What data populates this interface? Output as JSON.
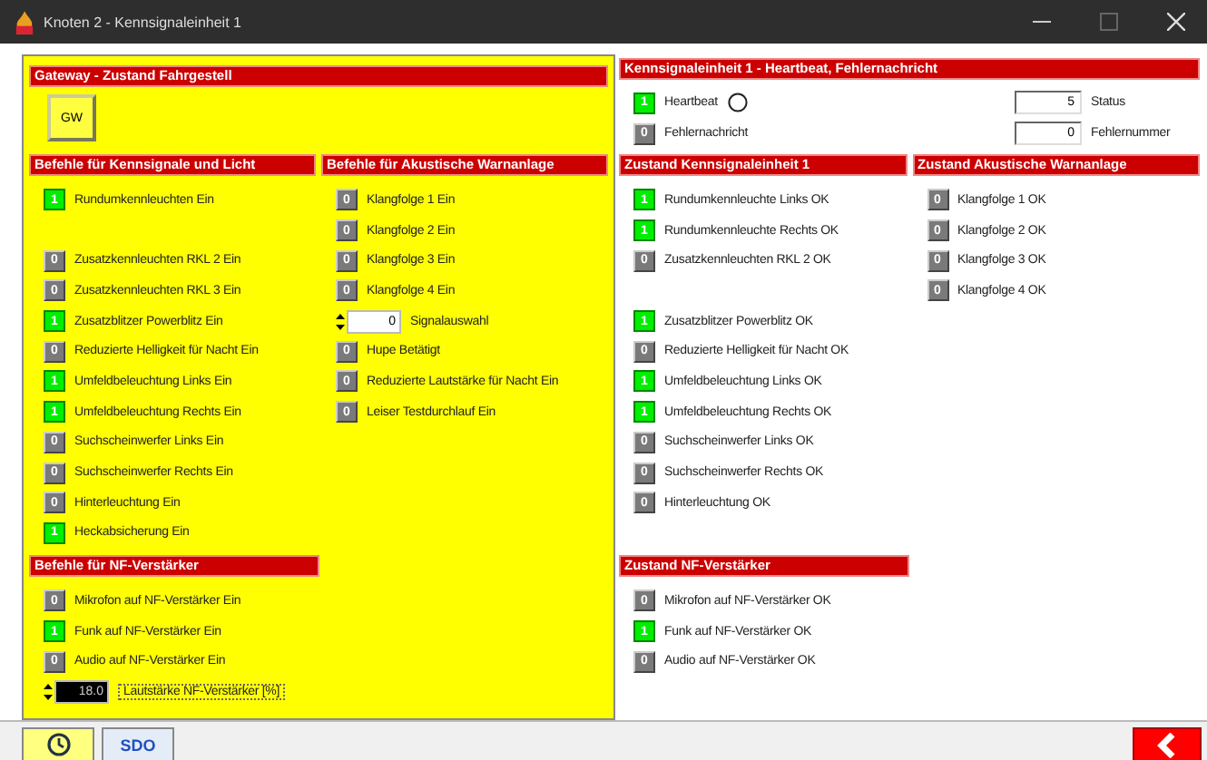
{
  "window": {
    "title": "Knoten 2 - Kennsignaleinheit 1"
  },
  "gateway": {
    "header": "Gateway - Zustand Fahrgestell",
    "button": "GW"
  },
  "light_commands": {
    "header": "Befehle für Kennsignale und Licht",
    "items": [
      {
        "kind": "indicator",
        "value": "1",
        "on": true,
        "label": "Rundumkennleuchten Ein"
      },
      {
        "kind": "spacer"
      },
      {
        "kind": "indicator",
        "value": "0",
        "on": false,
        "label": "Zusatzkennleuchten RKL 2 Ein"
      },
      {
        "kind": "indicator",
        "value": "0",
        "on": false,
        "label": "Zusatzkennleuchten RKL 3 Ein"
      },
      {
        "kind": "indicator",
        "value": "1",
        "on": true,
        "label": "Zusatzblitzer Powerblitz Ein"
      },
      {
        "kind": "indicator",
        "value": "0",
        "on": false,
        "label": "Reduzierte Helligkeit für Nacht Ein"
      },
      {
        "kind": "indicator",
        "value": "1",
        "on": true,
        "label": "Umfeldbeleuchtung Links Ein"
      },
      {
        "kind": "indicator",
        "value": "1",
        "on": true,
        "label": "Umfeldbeleuchtung Rechts Ein"
      },
      {
        "kind": "indicator",
        "value": "0",
        "on": false,
        "label": "Suchscheinwerfer Links Ein"
      },
      {
        "kind": "indicator",
        "value": "0",
        "on": false,
        "label": "Suchscheinwerfer Rechts Ein"
      },
      {
        "kind": "indicator",
        "value": "0",
        "on": false,
        "label": "Hinterleuchtung Ein"
      },
      {
        "kind": "indicator",
        "value": "1",
        "on": true,
        "label": "Heckabsicherung Ein"
      }
    ]
  },
  "acoustic_commands": {
    "header": "Befehle für Akustische Warnanlage",
    "items": [
      {
        "kind": "indicator",
        "value": "0",
        "on": false,
        "label": "Klangfolge 1 Ein"
      },
      {
        "kind": "indicator",
        "value": "0",
        "on": false,
        "label": "Klangfolge 2 Ein"
      },
      {
        "kind": "indicator",
        "value": "0",
        "on": false,
        "label": "Klangfolge 3 Ein"
      },
      {
        "kind": "indicator",
        "value": "0",
        "on": false,
        "label": "Klangfolge 4 Ein"
      },
      {
        "kind": "spinner",
        "value": "0",
        "label": "Signalauswahl"
      },
      {
        "kind": "indicator",
        "value": "0",
        "on": false,
        "label": "Hupe Betätigt"
      },
      {
        "kind": "indicator",
        "value": "0",
        "on": false,
        "label": "Reduzierte Lautstärke für Nacht Ein"
      },
      {
        "kind": "indicator",
        "value": "0",
        "on": false,
        "label": "Leiser Testdurchlauf Ein"
      }
    ]
  },
  "nf_commands": {
    "header": "Befehle für NF-Verstärker",
    "items": [
      {
        "kind": "indicator",
        "value": "0",
        "on": false,
        "label": "Mikrofon auf NF-Verstärker Ein"
      },
      {
        "kind": "indicator",
        "value": "1",
        "on": true,
        "label": "Funk auf NF-Verstärker Ein"
      },
      {
        "kind": "indicator",
        "value": "0",
        "on": false,
        "label": "Audio auf NF-Verstärker Ein"
      },
      {
        "kind": "volume",
        "value": "18.0",
        "label": "Lautstärke NF-Verstärker [%]"
      }
    ]
  },
  "heartbeat": {
    "header": "Kennsignaleinheit 1 - Heartbeat, Fehlernachricht",
    "items": [
      {
        "kind": "heartbeat",
        "value": "1",
        "on": true,
        "label": "Heartbeat"
      },
      {
        "kind": "indicator",
        "value": "0",
        "on": false,
        "label": "Fehlernachricht"
      }
    ],
    "fields": [
      {
        "value": "5",
        "label": "Status"
      },
      {
        "value": "0",
        "label": "Fehlernummer"
      }
    ]
  },
  "unit_status": {
    "header": "Zustand Kennsignaleinheit 1",
    "items": [
      {
        "kind": "indicator",
        "value": "1",
        "on": true,
        "label": "Rundumkennleuchte Links OK"
      },
      {
        "kind": "indicator",
        "value": "1",
        "on": true,
        "label": "Rundumkennleuchte Rechts OK"
      },
      {
        "kind": "indicator",
        "value": "0",
        "on": false,
        "label": "Zusatzkennleuchten RKL 2 OK"
      },
      {
        "kind": "spacer"
      },
      {
        "kind": "indicator",
        "value": "1",
        "on": true,
        "label": "Zusatzblitzer Powerblitz OK"
      },
      {
        "kind": "indicator",
        "value": "0",
        "on": false,
        "label": "Reduzierte Helligkeit für Nacht OK"
      },
      {
        "kind": "indicator",
        "value": "1",
        "on": true,
        "label": "Umfeldbeleuchtung Links OK"
      },
      {
        "kind": "indicator",
        "value": "1",
        "on": true,
        "label": "Umfeldbeleuchtung Rechts OK"
      },
      {
        "kind": "indicator",
        "value": "0",
        "on": false,
        "label": "Suchscheinwerfer Links OK"
      },
      {
        "kind": "indicator",
        "value": "0",
        "on": false,
        "label": "Suchscheinwerfer Rechts OK"
      },
      {
        "kind": "indicator",
        "value": "0",
        "on": false,
        "label": "Hinterleuchtung OK"
      }
    ]
  },
  "acoustic_status": {
    "header": "Zustand Akustische Warnanlage",
    "items": [
      {
        "kind": "indicator",
        "value": "0",
        "on": false,
        "label": "Klangfolge 1 OK"
      },
      {
        "kind": "indicator",
        "value": "0",
        "on": false,
        "label": "Klangfolge 2 OK"
      },
      {
        "kind": "indicator",
        "value": "0",
        "on": false,
        "label": "Klangfolge 3 OK"
      },
      {
        "kind": "indicator",
        "value": "0",
        "on": false,
        "label": "Klangfolge 4 OK"
      }
    ]
  },
  "nf_status": {
    "header": "Zustand NF-Verstärker",
    "items": [
      {
        "kind": "indicator",
        "value": "0",
        "on": false,
        "label": "Mikrofon auf NF-Verstärker OK"
      },
      {
        "kind": "indicator",
        "value": "1",
        "on": true,
        "label": "Funk auf NF-Verstärker OK"
      },
      {
        "kind": "indicator",
        "value": "0",
        "on": false,
        "label": "Audio auf NF-Verstärker OK"
      }
    ]
  },
  "toolbar": {
    "buttons": [
      {
        "kind": "clock"
      },
      {
        "kind": "text",
        "label": "SDO"
      }
    ],
    "back": {
      "kind": "back"
    }
  }
}
